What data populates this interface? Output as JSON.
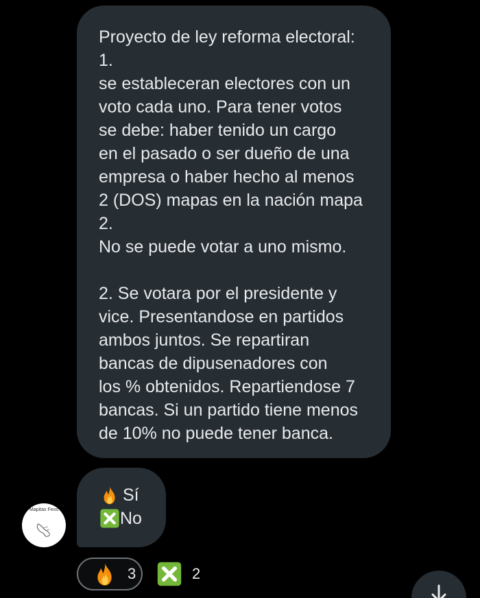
{
  "message": {
    "lines": [
      "Proyecto de ley reforma electoral:",
      "1.",
      "se estableceran electores con un",
      "voto cada uno. Para tener votos",
      "se debe: haber tenido un cargo",
      "en el pasado o ser dueño de una",
      "empresa o haber hecho al menos",
      "2 (DOS) mapas en la nación mapa",
      "2.",
      "No se puede votar a uno mismo.",
      "",
      "2. Se votara por el presidente y",
      "vice. Presentandose en partidos",
      "ambos juntos. Se repartiran",
      "bancas de dipusenadores con",
      "los % obtenidos. Repartiendose 7",
      "bancas. Si un partido tiene menos",
      "de 10% no puede tener banca."
    ]
  },
  "poll": {
    "options": [
      {
        "icon": "fire-icon",
        "label": "Sí"
      },
      {
        "icon": "cross-mark-button-icon",
        "label": "No"
      }
    ]
  },
  "avatar": {
    "text": "Mapitas Feos"
  },
  "reactions": [
    {
      "icon": "fire-icon",
      "count": "3",
      "selected": true
    },
    {
      "icon": "cross-mark-button-icon",
      "count": "2",
      "selected": false
    }
  ],
  "colors": {
    "background": "#000000",
    "bubble": "#262d33",
    "text": "#e8eaec",
    "cross_green": "#74b83a"
  }
}
